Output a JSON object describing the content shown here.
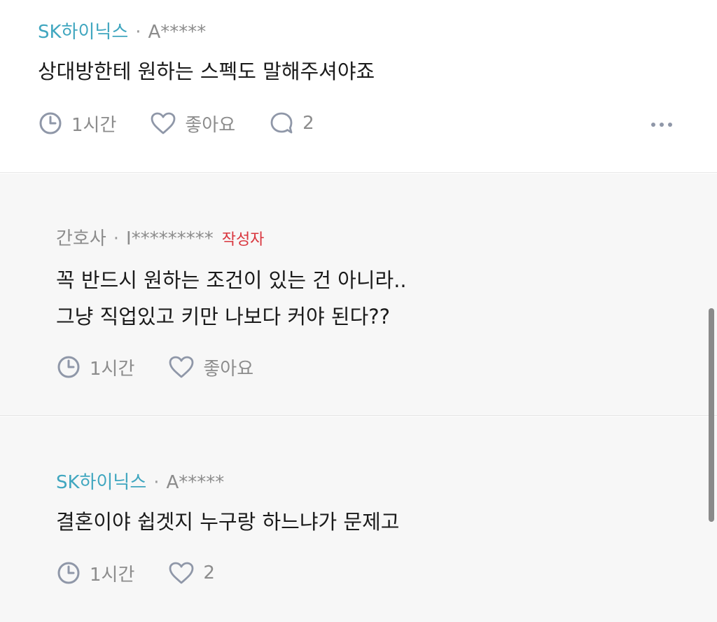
{
  "comments": [
    {
      "company": "SK하이닉스",
      "separator": "·",
      "user": "A*****",
      "body_lines": [
        "상대방한테 원하는 스펙도 말해주셔야죠"
      ],
      "time": "1시간",
      "like_label": "좋아요",
      "reply_count": "2"
    },
    {
      "company": "간호사",
      "separator": "·",
      "user": "I*********",
      "badge": "작성자",
      "body_lines": [
        "꼭 반드시 원하는 조건이 있는 건 아니라..",
        "그냥 직업있고 키만 나보다 커야 된다??"
      ],
      "time": "1시간",
      "like_label": "좋아요"
    },
    {
      "company": "SK하이닉스",
      "separator": "·",
      "user": "A*****",
      "body_lines": [
        "결혼이야 쉽겟지 누구랑 하느냐가 문제고"
      ],
      "time": "1시간",
      "like_label": "2"
    }
  ],
  "icons": {
    "clock": "clock-icon",
    "heart": "heart-icon",
    "comment": "comment-bubble-icon",
    "more": "more-options-icon"
  },
  "colors": {
    "company": "#3fa6bf",
    "badge": "#d9363e",
    "meta": "#8c8c8c",
    "reply_background": "#f7f7f7"
  }
}
